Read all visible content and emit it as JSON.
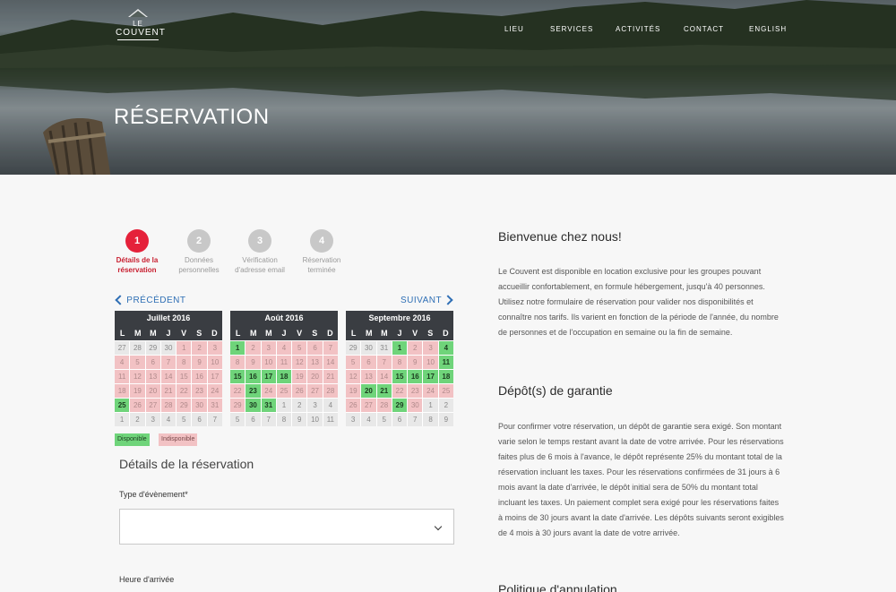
{
  "logo": {
    "le": "LE",
    "name": "COUVENT"
  },
  "nav": {
    "items": [
      "LIEU",
      "SERVICES",
      "ACTIVITÉS",
      "CONTACT",
      "ENGLISH"
    ]
  },
  "hero": {
    "title": "RÉSERVATION"
  },
  "steps": [
    {
      "number": "1",
      "label": "Détails de la réservation",
      "active": true
    },
    {
      "number": "2",
      "label": "Données personnelles",
      "active": false
    },
    {
      "number": "3",
      "label": "Vérification d'adresse email",
      "active": false
    },
    {
      "number": "4",
      "label": "Réservation terminée",
      "active": false
    }
  ],
  "calendar_nav": {
    "prev": "PRÉCÉDENT",
    "next": "SUIVANT"
  },
  "weekdays": [
    "L",
    "M",
    "M",
    "J",
    "V",
    "S",
    "D"
  ],
  "calendars": [
    {
      "month": "Juillet 2016",
      "days": [
        [
          "27",
          "x"
        ],
        [
          "28",
          "x"
        ],
        [
          "29",
          "x"
        ],
        [
          "30",
          "x"
        ],
        [
          "1",
          "u"
        ],
        [
          "2",
          "u"
        ],
        [
          "3",
          "u"
        ],
        [
          "4",
          "u"
        ],
        [
          "5",
          "u"
        ],
        [
          "6",
          "u"
        ],
        [
          "7",
          "u"
        ],
        [
          "8",
          "u"
        ],
        [
          "9",
          "u"
        ],
        [
          "10",
          "u"
        ],
        [
          "11",
          "u"
        ],
        [
          "12",
          "u"
        ],
        [
          "13",
          "u"
        ],
        [
          "14",
          "u"
        ],
        [
          "15",
          "u"
        ],
        [
          "16",
          "u"
        ],
        [
          "17",
          "u"
        ],
        [
          "18",
          "u"
        ],
        [
          "19",
          "u"
        ],
        [
          "20",
          "u"
        ],
        [
          "21",
          "u"
        ],
        [
          "22",
          "u"
        ],
        [
          "23",
          "u"
        ],
        [
          "24",
          "u"
        ],
        [
          "25",
          "a"
        ],
        [
          "26",
          "u"
        ],
        [
          "27",
          "u"
        ],
        [
          "28",
          "u"
        ],
        [
          "29",
          "u"
        ],
        [
          "30",
          "u"
        ],
        [
          "31",
          "u"
        ],
        [
          "1",
          "x"
        ],
        [
          "2",
          "x"
        ],
        [
          "3",
          "x"
        ],
        [
          "4",
          "x"
        ],
        [
          "5",
          "x"
        ],
        [
          "6",
          "x"
        ],
        [
          "7",
          "x"
        ]
      ]
    },
    {
      "month": "Août 2016",
      "days": [
        [
          "1",
          "a"
        ],
        [
          "2",
          "u"
        ],
        [
          "3",
          "u"
        ],
        [
          "4",
          "u"
        ],
        [
          "5",
          "u"
        ],
        [
          "6",
          "u"
        ],
        [
          "7",
          "u"
        ],
        [
          "8",
          "u"
        ],
        [
          "9",
          "u"
        ],
        [
          "10",
          "u"
        ],
        [
          "11",
          "u"
        ],
        [
          "12",
          "u"
        ],
        [
          "13",
          "u"
        ],
        [
          "14",
          "u"
        ],
        [
          "15",
          "a"
        ],
        [
          "16",
          "a"
        ],
        [
          "17",
          "a"
        ],
        [
          "18",
          "a"
        ],
        [
          "19",
          "u"
        ],
        [
          "20",
          "u"
        ],
        [
          "21",
          "u"
        ],
        [
          "22",
          "u"
        ],
        [
          "23",
          "a"
        ],
        [
          "24",
          "u"
        ],
        [
          "25",
          "u"
        ],
        [
          "26",
          "u"
        ],
        [
          "27",
          "u"
        ],
        [
          "28",
          "u"
        ],
        [
          "29",
          "u"
        ],
        [
          "30",
          "a"
        ],
        [
          "31",
          "a"
        ],
        [
          "1",
          "x"
        ],
        [
          "2",
          "x"
        ],
        [
          "3",
          "x"
        ],
        [
          "4",
          "x"
        ],
        [
          "5",
          "x"
        ],
        [
          "6",
          "x"
        ],
        [
          "7",
          "x"
        ],
        [
          "8",
          "x"
        ],
        [
          "9",
          "x"
        ],
        [
          "10",
          "x"
        ],
        [
          "11",
          "x"
        ]
      ]
    },
    {
      "month": "Septembre 2016",
      "days": [
        [
          "29",
          "x"
        ],
        [
          "30",
          "x"
        ],
        [
          "31",
          "x"
        ],
        [
          "1",
          "a"
        ],
        [
          "2",
          "u"
        ],
        [
          "3",
          "u"
        ],
        [
          "4",
          "a"
        ],
        [
          "5",
          "u"
        ],
        [
          "6",
          "u"
        ],
        [
          "7",
          "u"
        ],
        [
          "8",
          "u"
        ],
        [
          "9",
          "u"
        ],
        [
          "10",
          "u"
        ],
        [
          "11",
          "a"
        ],
        [
          "12",
          "u"
        ],
        [
          "13",
          "u"
        ],
        [
          "14",
          "u"
        ],
        [
          "15",
          "a"
        ],
        [
          "16",
          "a"
        ],
        [
          "17",
          "a"
        ],
        [
          "18",
          "a"
        ],
        [
          "19",
          "u"
        ],
        [
          "20",
          "a"
        ],
        [
          "21",
          "a"
        ],
        [
          "22",
          "u"
        ],
        [
          "23",
          "u"
        ],
        [
          "24",
          "u"
        ],
        [
          "25",
          "u"
        ],
        [
          "26",
          "u"
        ],
        [
          "27",
          "u"
        ],
        [
          "28",
          "u"
        ],
        [
          "29",
          "a"
        ],
        [
          "30",
          "u"
        ],
        [
          "1",
          "x"
        ],
        [
          "2",
          "x"
        ],
        [
          "3",
          "x"
        ],
        [
          "4",
          "x"
        ],
        [
          "5",
          "x"
        ],
        [
          "6",
          "x"
        ],
        [
          "7",
          "x"
        ],
        [
          "8",
          "x"
        ],
        [
          "9",
          "x"
        ]
      ]
    }
  ],
  "legend": {
    "available": "Disponible",
    "unavailable": "Indisponible"
  },
  "form": {
    "section_title": "Détails de la réservation",
    "event_type_label": "Type d'évènement*",
    "event_type_value": "",
    "arrival_label": "Heure d'arrivée"
  },
  "info": {
    "welcome_title": "Bienvenue chez nous!",
    "welcome_text": "Le Couvent est disponible en location exclusive pour les groupes pouvant accueillir confortablement, en formule hébergement, jusqu'à 40 personnes. Utilisez notre formulaire de réservation pour valider nos disponibilités et connaître nos tarifs. Ils varient en fonction de la période de l'année, du nombre de personnes et de l'occupation en semaine ou la fin de semaine.",
    "deposit_title": "Dépôt(s) de garantie",
    "deposit_text": "Pour confirmer votre réservation, un dépôt de garantie sera exigé. Son montant varie selon le temps restant avant la date de votre arrivée. Pour les réservations faites plus de 6 mois à l'avance, le dépôt représente 25% du montant total de la réservation incluant les taxes. Pour les réservations confirmées de 31 jours à 6 mois avant la date d'arrivée, le dépôt initial sera de 50% du montant total incluant les taxes. Un paiement complet sera exigé pour les réservations faites à moins de 30 jours avant la date d'arrivée. Les dépôts suivants seront exigibles de 4 mois à 30 jours avant la date de votre arrivée.",
    "cancel_title": "Politique d'annulation"
  },
  "colors": {
    "accent_red": "#e5213a",
    "available_green": "#6fd47a",
    "unavailable_pink": "#f2c2c4",
    "link_blue": "#2f6fb5"
  }
}
